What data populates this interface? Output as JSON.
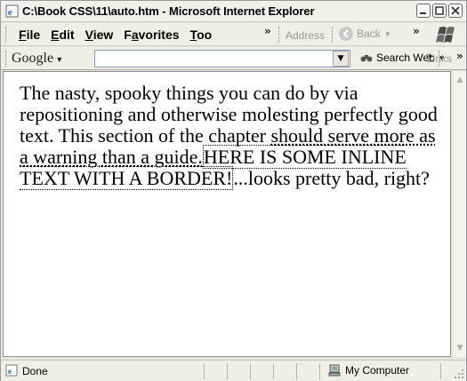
{
  "window": {
    "title": "C:\\Book CSS\\11\\auto.htm - Microsoft Internet Explorer"
  },
  "menu": {
    "items": [
      {
        "label": "File",
        "accel": "F",
        "rest": "ile"
      },
      {
        "label": "Edit",
        "accel": "E",
        "rest": "dit"
      },
      {
        "label": "View",
        "accel": "V",
        "rest": "iew"
      },
      {
        "label": "Favorites",
        "accel": "a",
        "pre": "F",
        "rest": "vorites"
      },
      {
        "label": "Too",
        "accel": "T",
        "rest": "oo"
      }
    ],
    "overflow": "»",
    "address_label": "Address",
    "back_label": "Back",
    "back_overflow": "»"
  },
  "google_toolbar": {
    "label": "Google",
    "search_value": "",
    "search_web_label": "Search Web",
    "overflow": "»",
    "links_label": "Links",
    "links_overflow": "»"
  },
  "content": {
    "part1": "The nasty, spooky things you can do by via repositioning and otherwise molesting perfectly good text. This section of the chapter ",
    "underlined": "should serve more as a warning than a guide.",
    "bordered": "HERE IS SOME INLINE TEXT WITH A BORDER!",
    "part2": "...looks pretty bad, right?"
  },
  "status": {
    "text": "Done",
    "zone": "My Computer"
  },
  "colors": {
    "content_bg": "#ffffff",
    "chrome_bg": "#efeee9"
  }
}
